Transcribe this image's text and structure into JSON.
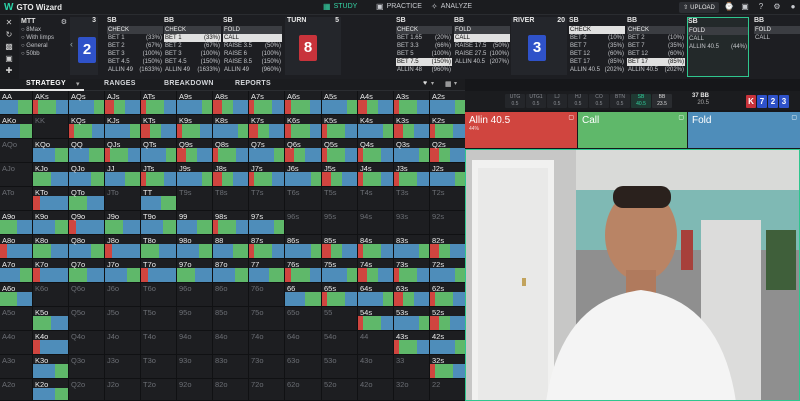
{
  "app": {
    "title": "GTO Wizard",
    "logo_glyph": "W"
  },
  "nav": {
    "tabs": [
      {
        "label": "STUDY",
        "icon": "study-icon",
        "active": true
      },
      {
        "label": "PRACTICE",
        "icon": "gamepad-icon",
        "active": false
      },
      {
        "label": "ANALYZE",
        "icon": "bulb-icon",
        "active": false
      }
    ],
    "upload_label": "UPLOAD"
  },
  "game": {
    "title": "MTT",
    "lines": [
      "8Max",
      "With limps",
      "General",
      "50bb"
    ]
  },
  "columns": [
    {
      "pos": "SB",
      "num": "",
      "rows": [
        {
          "a": "CHECK",
          "p": ""
        },
        {
          "a": "BET 1",
          "p": "(33%)"
        },
        {
          "a": "BET 2",
          "p": "(67%)"
        },
        {
          "a": "BET 3",
          "p": "(100%)"
        },
        {
          "a": "BET 4.5",
          "p": "(150%)"
        },
        {
          "a": "ALLIN 49",
          "p": "(1633%)"
        }
      ],
      "sel": -1
    },
    {
      "pos": "BB",
      "num": "",
      "rows": [
        {
          "a": "CHECK",
          "p": ""
        },
        {
          "a": "BET 1",
          "p": "(33%)"
        },
        {
          "a": "BET 2",
          "p": "(67%)"
        },
        {
          "a": "BET 3",
          "p": "(100%)"
        },
        {
          "a": "BET 4.5",
          "p": "(150%)"
        },
        {
          "a": "ALLIN 49",
          "p": "(1633%)"
        }
      ],
      "sel": 1
    },
    {
      "pos": "SB",
      "num": "",
      "rows": [
        {
          "a": "FOLD",
          "p": ""
        },
        {
          "a": "CALL",
          "p": ""
        },
        {
          "a": "RAISE 3.5",
          "p": "(50%)"
        },
        {
          "a": "RAISE 6",
          "p": "(100%)"
        },
        {
          "a": "RAISE 8.5",
          "p": "(150%)"
        },
        {
          "a": "ALLIN 49",
          "p": "(960%)"
        }
      ],
      "sel": 1
    },
    {
      "pos": "SB",
      "num": "",
      "rows": [
        {
          "a": "CHECK",
          "p": ""
        },
        {
          "a": "BET 1.65",
          "p": "(20%)"
        },
        {
          "a": "BET 3.3",
          "p": "(66%)"
        },
        {
          "a": "BET 5",
          "p": "(100%)"
        },
        {
          "a": "BET 7.5",
          "p": "(150%)"
        },
        {
          "a": "ALLIN 48",
          "p": "(960%)"
        }
      ],
      "sel": 4
    },
    {
      "pos": "BB",
      "num": "",
      "rows": [
        {
          "a": "FOLD",
          "p": ""
        },
        {
          "a": "CALL",
          "p": ""
        },
        {
          "a": "RAISE 17.5",
          "p": "(50%)"
        },
        {
          "a": "RAISE 27.5",
          "p": "(100%)"
        },
        {
          "a": "ALLIN 40.5",
          "p": "(207%)"
        }
      ],
      "sel": 1
    },
    {
      "pos": "SB",
      "num": "",
      "rows": [
        {
          "a": "CHECK",
          "p": ""
        },
        {
          "a": "BET 2",
          "p": "(10%)"
        },
        {
          "a": "BET 7",
          "p": "(35%)"
        },
        {
          "a": "BET 12",
          "p": "(60%)"
        },
        {
          "a": "BET 17",
          "p": "(85%)"
        },
        {
          "a": "ALLIN 40.5",
          "p": "(202%)"
        }
      ],
      "sel": 0
    },
    {
      "pos": "BB",
      "num": "",
      "rows": [
        {
          "a": "CHECK",
          "p": ""
        },
        {
          "a": "BET 2",
          "p": "(10%)"
        },
        {
          "a": "BET 7",
          "p": "(35%)"
        },
        {
          "a": "BET 12",
          "p": "(60%)"
        },
        {
          "a": "BET 17",
          "p": "(85%)"
        },
        {
          "a": "ALLIN 40.5",
          "p": "(202%)"
        }
      ],
      "sel": 4
    },
    {
      "pos": "SB",
      "num": "",
      "rows": [
        {
          "a": "FOLD",
          "p": ""
        },
        {
          "a": "CALL",
          "p": ""
        },
        {
          "a": "ALLIN 40.5",
          "p": "(44%)"
        }
      ],
      "sel": -1
    },
    {
      "pos": "BB",
      "num": "",
      "rows": [
        {
          "a": "FOLD",
          "p": ""
        },
        {
          "a": "CALL",
          "p": ""
        }
      ],
      "sel": -1
    }
  ],
  "streets": [
    {
      "label": "TURN",
      "pot": "5",
      "card": "8",
      "color": "#c8333b"
    },
    {
      "label": "RIVER",
      "pot": "20",
      "card": "3",
      "color": "#2f52c9"
    }
  ],
  "board": {
    "flop_num": "3",
    "flop_card": "2",
    "flop_color": "#2f52c9"
  },
  "strategy_tabs": [
    "STRATEGY",
    "RANGES",
    "BREAKDOWN",
    "REPORTS"
  ],
  "positions": [
    {
      "label": "UTG",
      "bb": "0.5"
    },
    {
      "label": "UTG1",
      "bb": "0.5"
    },
    {
      "label": "LJ",
      "bb": "0.5"
    },
    {
      "label": "HJ",
      "bb": "0.5"
    },
    {
      "label": "CO",
      "bb": "0.5"
    },
    {
      "label": "BTN",
      "bb": "0.5"
    },
    {
      "label": "SB",
      "bb": "40.5",
      "on": true
    },
    {
      "label": "BB",
      "bb": "23.5"
    }
  ],
  "stack": {
    "line1": "37 BB",
    "line2": "20.5"
  },
  "board_cards": [
    {
      "r": "K",
      "c": "#c8333b"
    },
    {
      "r": "7",
      "c": "#2f52c9"
    },
    {
      "r": "2",
      "c": "#2f52c9"
    },
    {
      "r": "3",
      "c": "#2f52c9"
    }
  ],
  "actions": [
    {
      "label": "Allin 40.5",
      "sub": "44%",
      "color": "#d0453f"
    },
    {
      "label": "Call",
      "sub": "",
      "color": "#5fb86a"
    },
    {
      "label": "Fold",
      "sub": "",
      "color": "#4e8dba"
    }
  ],
  "colors": {
    "allin": "#d0453f",
    "call": "#5fb86a",
    "fold": "#4e8dba",
    "accent": "#35d6a6"
  },
  "grid_labels": [
    [
      "AA",
      "AKs",
      "AQs",
      "AJs",
      "ATs",
      "A9s",
      "A8s",
      "A7s",
      "A6s",
      "A5s",
      "A4s",
      "A3s",
      "A2s"
    ],
    [
      "AKo",
      "KK",
      "KQs",
      "KJs",
      "KTs",
      "K9s",
      "K8s",
      "K7s",
      "K6s",
      "K5s",
      "K4s",
      "K3s",
      "K2s"
    ],
    [
      "AQo",
      "KQo",
      "QQ",
      "QJs",
      "QTs",
      "Q9s",
      "Q8s",
      "Q7s",
      "Q6s",
      "Q5s",
      "Q4s",
      "Q3s",
      "Q2s"
    ],
    [
      "AJo",
      "KJo",
      "QJo",
      "JJ",
      "JTs",
      "J9s",
      "J8s",
      "J7s",
      "J6s",
      "J5s",
      "J4s",
      "J3s",
      "J2s"
    ],
    [
      "ATo",
      "KTo",
      "QTo",
      "JTo",
      "TT",
      "T9s",
      "T8s",
      "T7s",
      "T6s",
      "T5s",
      "T4s",
      "T3s",
      "T2s"
    ],
    [
      "A9o",
      "K9o",
      "Q9o",
      "J9o",
      "T9o",
      "99",
      "98s",
      "97s",
      "96s",
      "95s",
      "94s",
      "93s",
      "92s"
    ],
    [
      "A8o",
      "K8o",
      "Q8o",
      "J8o",
      "T8o",
      "98o",
      "88",
      "87s",
      "86s",
      "85s",
      "84s",
      "83s",
      "82s"
    ],
    [
      "A7o",
      "K7o",
      "Q7o",
      "J7o",
      "T7o",
      "97o",
      "87o",
      "77",
      "76s",
      "75s",
      "74s",
      "73s",
      "72s"
    ],
    [
      "A6o",
      "K6o",
      "Q6o",
      "J6o",
      "T6o",
      "96o",
      "86o",
      "76o",
      "66",
      "65s",
      "64s",
      "63s",
      "62s"
    ],
    [
      "A5o",
      "K5o",
      "Q5o",
      "J5o",
      "T5o",
      "95o",
      "85o",
      "75o",
      "65o",
      "55",
      "54s",
      "53s",
      "52s"
    ],
    [
      "A4o",
      "K4o",
      "Q4o",
      "J4o",
      "T4o",
      "94o",
      "84o",
      "74o",
      "64o",
      "54o",
      "44",
      "43s",
      "42s"
    ],
    [
      "A3o",
      "K3o",
      "Q3o",
      "J3o",
      "T3o",
      "93o",
      "83o",
      "73o",
      "63o",
      "53o",
      "43o",
      "33",
      "32s"
    ],
    [
      "A2o",
      "K2o",
      "Q2o",
      "J2o",
      "T2o",
      "92o",
      "82o",
      "72o",
      "62o",
      "52o",
      "42o",
      "32o",
      "22"
    ]
  ]
}
